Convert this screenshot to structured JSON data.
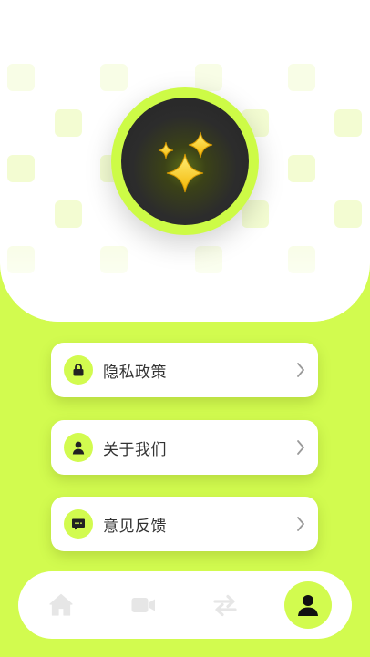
{
  "menu": {
    "items": [
      {
        "label": "隐私政策",
        "icon": "lock-icon"
      },
      {
        "label": "关于我们",
        "icon": "user-icon"
      },
      {
        "label": "意见反馈",
        "icon": "message-icon"
      }
    ]
  },
  "tabbar": {
    "items": [
      {
        "icon": "home-icon",
        "active": false
      },
      {
        "icon": "video-icon",
        "active": false
      },
      {
        "icon": "swap-icon",
        "active": false
      },
      {
        "icon": "profile-icon",
        "active": true
      }
    ]
  },
  "colors": {
    "accent": "#d2fb4f",
    "card": "#ffffff",
    "text": "#333333",
    "tab_inactive": "#e6e6e6"
  }
}
